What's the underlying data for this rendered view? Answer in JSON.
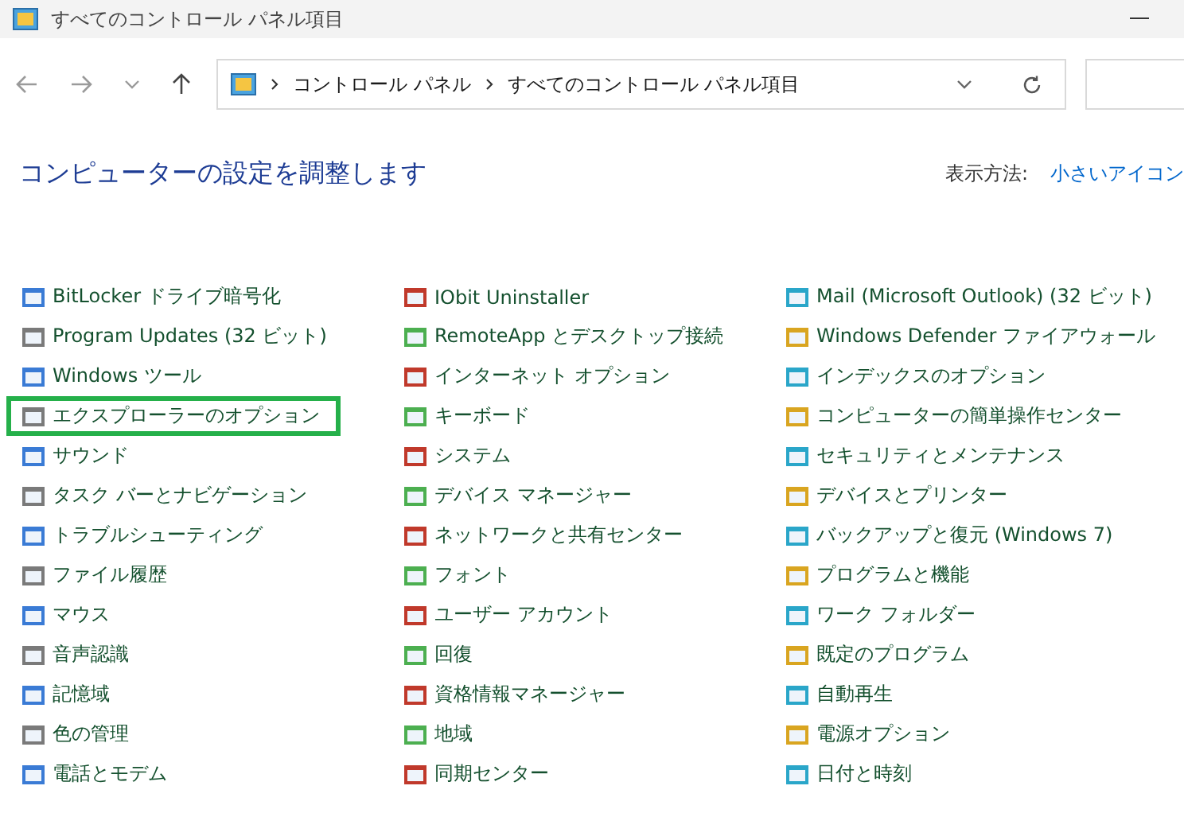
{
  "window": {
    "title": "すべてのコントロール パネル項目"
  },
  "address": {
    "breadcrumbs": [
      "コントロール パネル",
      "すべてのコントロール パネル項目"
    ]
  },
  "heading": "コンピューターの設定を調整します",
  "view_by": {
    "label": "表示方法:",
    "value": "小さいアイコン"
  },
  "columns": [
    [
      {
        "label": "BitLocker ドライブ暗号化",
        "selected": false
      },
      {
        "label": "Program Updates (32 ビット)",
        "selected": false
      },
      {
        "label": "Windows ツール",
        "selected": false
      },
      {
        "label": "エクスプローラーのオプション",
        "selected": true
      },
      {
        "label": "サウンド",
        "selected": false
      },
      {
        "label": "タスク バーとナビゲーション",
        "selected": false
      },
      {
        "label": "トラブルシューティング",
        "selected": false
      },
      {
        "label": "ファイル履歴",
        "selected": false
      },
      {
        "label": "マウス",
        "selected": false
      },
      {
        "label": "音声認識",
        "selected": false
      },
      {
        "label": "記憶域",
        "selected": false
      },
      {
        "label": "色の管理",
        "selected": false
      },
      {
        "label": "電話とモデム",
        "selected": false
      }
    ],
    [
      {
        "label": "IObit Uninstaller",
        "selected": false
      },
      {
        "label": "RemoteApp とデスクトップ接続",
        "selected": false
      },
      {
        "label": "インターネット オプション",
        "selected": false
      },
      {
        "label": "キーボード",
        "selected": false
      },
      {
        "label": "システム",
        "selected": false
      },
      {
        "label": "デバイス マネージャー",
        "selected": false
      },
      {
        "label": "ネットワークと共有センター",
        "selected": false
      },
      {
        "label": "フォント",
        "selected": false
      },
      {
        "label": "ユーザー アカウント",
        "selected": false
      },
      {
        "label": "回復",
        "selected": false
      },
      {
        "label": "資格情報マネージャー",
        "selected": false
      },
      {
        "label": "地域",
        "selected": false
      },
      {
        "label": "同期センター",
        "selected": false
      }
    ],
    [
      {
        "label": "Mail (Microsoft Outlook) (32 ビット)",
        "selected": false
      },
      {
        "label": "Windows Defender ファイアウォール",
        "selected": false
      },
      {
        "label": "インデックスのオプション",
        "selected": false
      },
      {
        "label": "コンピューターの簡単操作センター",
        "selected": false
      },
      {
        "label": "セキュリティとメンテナンス",
        "selected": false
      },
      {
        "label": "デバイスとプリンター",
        "selected": false
      },
      {
        "label": "バックアップと復元 (Windows 7)",
        "selected": false
      },
      {
        "label": "プログラムと機能",
        "selected": false
      },
      {
        "label": "ワーク フォルダー",
        "selected": false
      },
      {
        "label": "既定のプログラム",
        "selected": false
      },
      {
        "label": "自動再生",
        "selected": false
      },
      {
        "label": "電源オプション",
        "selected": false
      },
      {
        "label": "日付と時刻",
        "selected": false
      }
    ]
  ]
}
